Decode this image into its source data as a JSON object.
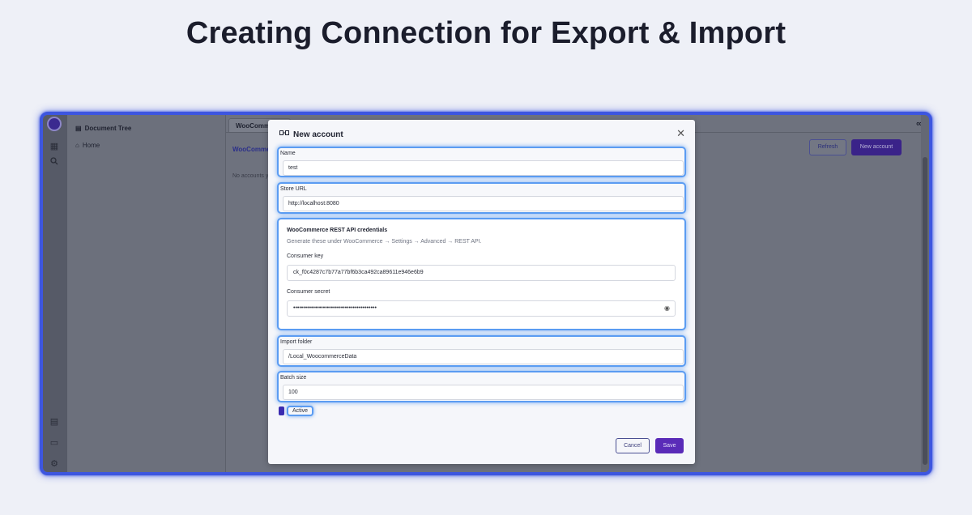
{
  "heading": "Creating Connection for Export & Import",
  "background_app": {
    "sidebar": {
      "title": "Document Tree",
      "home": "Home"
    },
    "tab_label": "WooCommerce",
    "section_label": "WooCommerce",
    "empty_text": "No accounts yet",
    "refresh_label": "Refresh",
    "new_account_label": "New account"
  },
  "modal": {
    "title": "New account",
    "name": {
      "label": "Name",
      "value": "test"
    },
    "store_url": {
      "label": "Store URL",
      "value": "http://localhost:8080"
    },
    "credentials": {
      "title": "WooCommerce REST API credentials",
      "hint": "Generate these under WooCommerce → Settings → Advanced → REST API.",
      "consumer_key": {
        "label": "Consumer key",
        "value": "ck_f0c4287c7b77a77bf6b3ca492ca89611e946e6b9"
      },
      "consumer_secret": {
        "label": "Consumer secret",
        "value": "••••••••••••••••••••••••••••••••••••••••••"
      }
    },
    "import_folder": {
      "label": "Import folder",
      "value": "/Local_WoocommerceData"
    },
    "batch_size": {
      "label": "Batch size",
      "value": "100"
    },
    "active_label": "Active",
    "cancel_label": "Cancel",
    "save_label": "Save"
  },
  "colors": {
    "frame_highlight": "#3d56e0",
    "field_highlight": "#5b9cf2",
    "primary_button": "#5a2bb8"
  }
}
